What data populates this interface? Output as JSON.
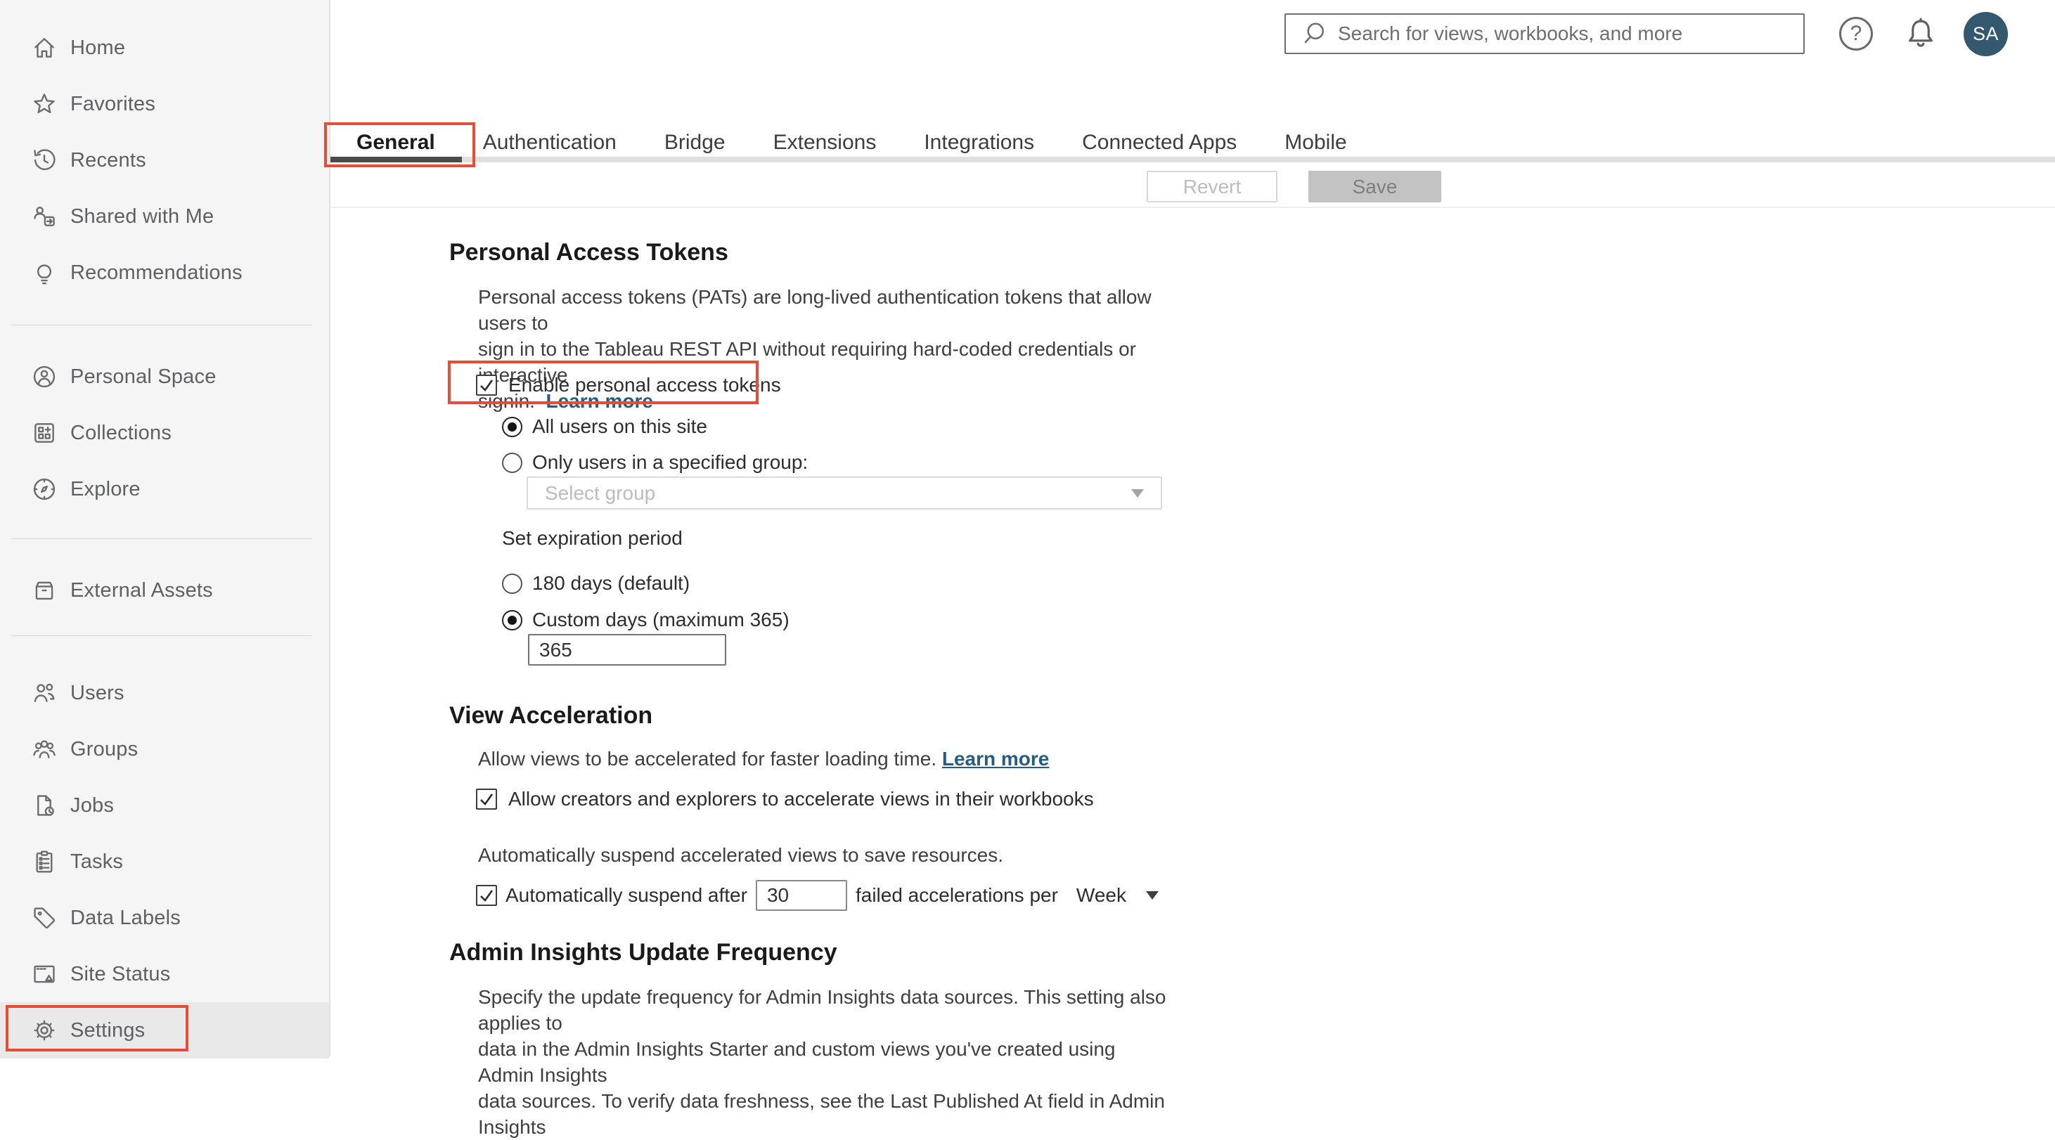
{
  "colors": {
    "annotation_red": "#e94c35",
    "link_blue": "#255c7f",
    "avatar_bg": "#34586e",
    "tab_ink": "#4b4b4b",
    "sidebar_bg": "#f5f5f6"
  },
  "topbar": {
    "search_placeholder": "Search for views, workbooks, and more",
    "avatar_initials": "SA",
    "help_glyph": "?"
  },
  "icons": {
    "search-icon": "magnifier",
    "help-icon": "question-mark-circle",
    "notifications-icon": "bell",
    "home-icon": "house",
    "favorites-icon": "star",
    "recents-icon": "clock-history",
    "shared-icon": "person-share-arrow",
    "recommendations-icon": "lightbulb",
    "personal-space-icon": "person-circle",
    "collections-icon": "grid-plus",
    "explore-icon": "compass",
    "external-assets-icon": "storage-box",
    "users-icon": "two-people",
    "groups-icon": "three-people",
    "jobs-icon": "document-clock",
    "tasks-icon": "clipboard-list",
    "data-labels-icon": "tag",
    "site-status-icon": "browser-alert",
    "settings-icon": "gear",
    "dropdown-caret-icon": "triangle-down"
  },
  "sidebar": {
    "items": [
      {
        "label": "Home"
      },
      {
        "label": "Favorites"
      },
      {
        "label": "Recents"
      },
      {
        "label": "Shared with Me"
      },
      {
        "label": "Recommendations"
      },
      {
        "label": "Personal Space"
      },
      {
        "label": "Collections"
      },
      {
        "label": "Explore"
      },
      {
        "label": "External Assets"
      },
      {
        "label": "Users"
      },
      {
        "label": "Groups"
      },
      {
        "label": "Jobs"
      },
      {
        "label": "Tasks"
      },
      {
        "label": "Data Labels"
      },
      {
        "label": "Site Status"
      },
      {
        "label": "Settings"
      }
    ]
  },
  "tabs": {
    "items": [
      {
        "label": "General",
        "active": true
      },
      {
        "label": "Authentication"
      },
      {
        "label": "Bridge"
      },
      {
        "label": "Extensions"
      },
      {
        "label": "Integrations"
      },
      {
        "label": "Connected Apps"
      },
      {
        "label": "Mobile"
      }
    ]
  },
  "toolbar": {
    "revert": "Revert",
    "save": "Save"
  },
  "pat": {
    "title": "Personal Access Tokens",
    "desc_line1": "Personal access tokens (PATs) are long-lived authentication tokens that allow users to",
    "desc_line2": "sign in to the Tableau REST API without requiring hard-coded credentials or interactive",
    "desc_line3": "signin.",
    "learn_more": "Learn more",
    "enable_label": "Enable personal access tokens",
    "radio_all_users": "All users on this site",
    "radio_specified_group": "Only users in a specified group:",
    "group_select_placeholder": "Select group",
    "expiration_label": "Set expiration period",
    "radio_180": "180 days (default)",
    "radio_custom": "Custom days (maximum 365)",
    "custom_days_value": "365"
  },
  "view_acceleration": {
    "title": "View Acceleration",
    "desc": "Allow views to be accelerated for faster loading time.",
    "learn_more": "Learn more",
    "allow_label": "Allow creators and explorers to accelerate views in their workbooks",
    "suspend_desc": "Automatically suspend accelerated views to save resources.",
    "suspend_prefix": "Automatically suspend after",
    "suspend_value": "30",
    "suspend_suffix": "failed accelerations per",
    "period": "Week"
  },
  "admin_insights": {
    "title": "Admin Insights Update Frequency",
    "desc_line1": "Specify the update frequency for Admin Insights data sources. This setting also applies to",
    "desc_line2": "data in the Admin Insights Starter and custom views you've created using Admin Insights",
    "desc_line3": "data sources. To verify data freshness, see the Last Published At field in Admin Insights"
  }
}
